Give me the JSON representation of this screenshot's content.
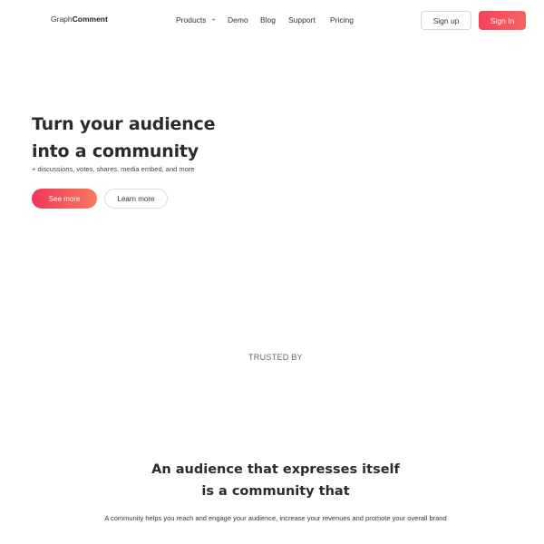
{
  "header": {
    "logo": {
      "prefix": "Graph",
      "bold": "Comment"
    },
    "nav": [
      {
        "label": "Products"
      },
      {
        "label": "Demo"
      },
      {
        "label": "Blog"
      },
      {
        "label": "Support"
      },
      {
        "label": "Pricing"
      }
    ],
    "signup_label": "Sign up",
    "signin_label": "Sign In"
  },
  "hero": {
    "title_line1": "Turn your audience",
    "title_line2": "into a community",
    "subtitle": "+ discussions, votes, shares, media embed, and more",
    "see_more_label": "See more",
    "learn_more_label": "Learn more"
  },
  "trusted": {
    "label": "TRUSTED BY"
  },
  "section": {
    "title_line1": "An audience that expresses itself",
    "title_line2": "is a community that",
    "subtitle": "A community helps you reach and engage your audience, increase your revenues and promote your overall brand"
  },
  "icons": {
    "products_dropdown": "chevron-down-icon"
  },
  "colors": {
    "accent_start": "#f0355e",
    "accent_end": "#f97a5c",
    "text": "#2b2b2b"
  }
}
